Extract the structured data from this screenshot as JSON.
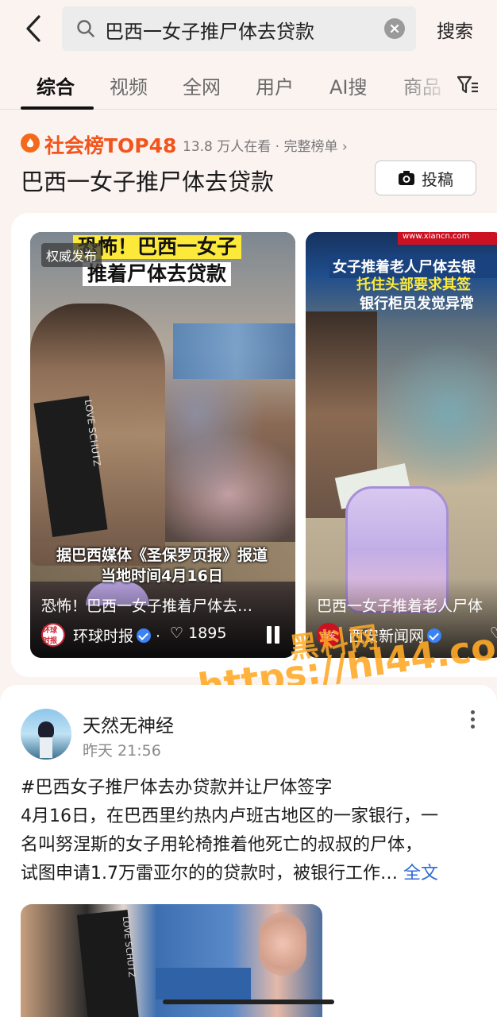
{
  "search": {
    "query": "巴西一女子推尸体去贷款",
    "button_label": "搜索"
  },
  "tabs": [
    {
      "label": "综合",
      "active": true
    },
    {
      "label": "视频"
    },
    {
      "label": "全网"
    },
    {
      "label": "用户"
    },
    {
      "label": "AI搜"
    },
    {
      "label": "商品"
    }
  ],
  "trend": {
    "rank_label": "社会榜TOP48",
    "meta": "13.8 万人在看 · 完整榜单",
    "headline": "巴西一女子推尸体去贷款",
    "post_button": "投稿"
  },
  "videos": [
    {
      "badge": "权威发布",
      "caption_top": "恐怖！巴西一女子",
      "caption_bottom": "推着尸体去贷款",
      "mid_caption_1": "据巴西媒体《圣保罗页报》报道",
      "mid_caption_2": "当地时间4月16日",
      "title": "恐怖！巴西一女子推着尸体去…",
      "source": "环球时报",
      "likes": "1895",
      "logo_text": "环球时报"
    },
    {
      "caption_line1": "女子推着老人尸体去银",
      "caption_line2": "托住头部要求其签",
      "caption_line3": "银行柜员发觉异常",
      "site": "www.xiancn.com",
      "title": "巴西一女子推着老人尸体",
      "source": "西安新闻网",
      "logo_text": "西安"
    }
  ],
  "watermark": {
    "line1": "黑料网",
    "line2": "https://hl44.co"
  },
  "post": {
    "author": "天然无神经",
    "time": "昨天 21:56",
    "lines": [
      "#巴西女子推尸体去办贷款并让尸体签字",
      "4月16日，在巴西里约热内卢班古地区的一家银行，一",
      "名叫努涅斯的女子用轮椅推着他死亡的叔叔的尸体，",
      "试图申请1.7万雷亚尔的的贷款时，被银行工作…"
    ],
    "full_text_label": "全文",
    "image_bag_text": "LOVE SCHUTZ"
  },
  "colors": {
    "accent_orange": "#f2551c",
    "link_blue": "#2f6bd6",
    "caption_yellow": "#fde93a"
  }
}
